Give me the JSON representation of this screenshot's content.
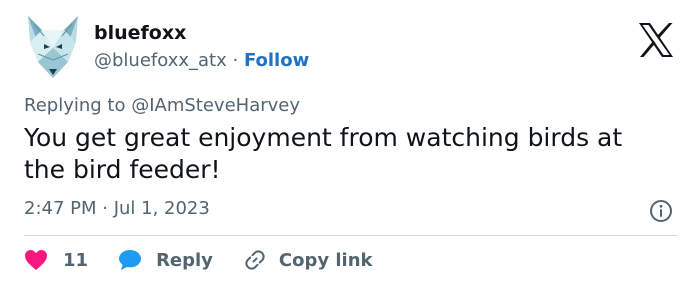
{
  "author": {
    "display_name": "bluefoxx",
    "handle": "@bluefoxx_atx",
    "separator": "·",
    "follow_label": "Follow"
  },
  "reply_context": {
    "prefix": "Replying to",
    "target": "@IAmSteveHarvey"
  },
  "tweet": {
    "text": "You get great enjoyment from watching birds at the bird feeder!",
    "timestamp": "2:47 PM · Jul 1, 2023"
  },
  "actions": {
    "like_count": "11",
    "reply_label": "Reply",
    "copy_label": "Copy link"
  },
  "colors": {
    "accent": "#1d72c4",
    "like": "#f91880",
    "muted_text": "#536471"
  },
  "icons": {
    "avatar": "fox-avatar",
    "brand": "x-logo-icon",
    "info": "info-icon",
    "like": "heart-icon",
    "reply": "speech-bubble-icon",
    "copy": "link-icon"
  }
}
